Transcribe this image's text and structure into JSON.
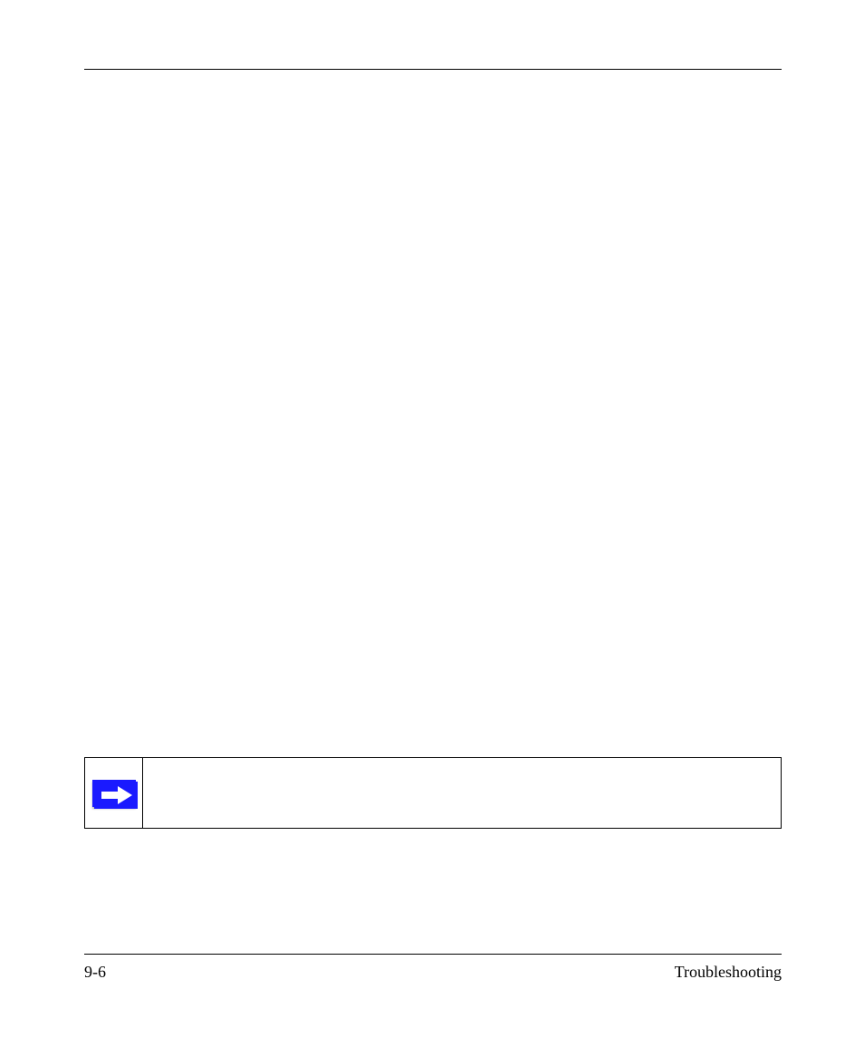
{
  "footer": {
    "page_number": "9-6",
    "section_title": "Troubleshooting"
  },
  "note": {
    "icon_name": "arrow-right-icon",
    "text": ""
  }
}
